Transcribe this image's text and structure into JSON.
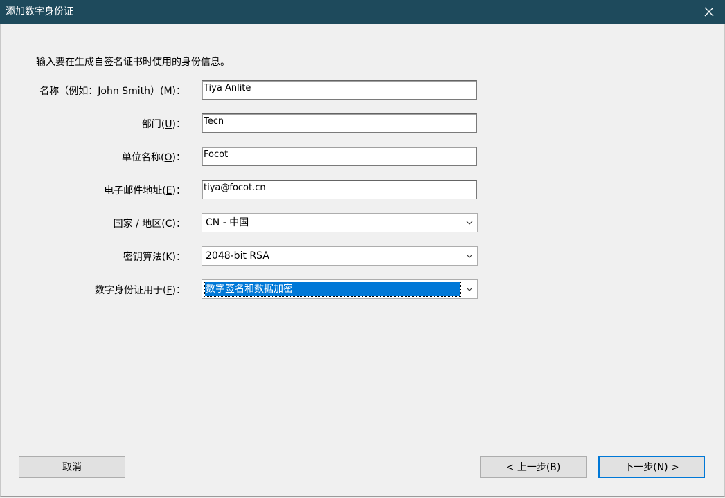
{
  "window": {
    "title": "添加数字身份证",
    "close_icon": "close-icon"
  },
  "instruction": "输入要在生成自签名证书时使用的身份信息。",
  "fields": {
    "name": {
      "label_pre": "名称（例如：John Smith）(",
      "key": "M",
      "label_post": ")：",
      "value": "Tiya Anlite"
    },
    "department": {
      "label_pre": "部门(",
      "key": "U",
      "label_post": ")：",
      "value": "Tecn"
    },
    "organization": {
      "label_pre": "单位名称(",
      "key": "O",
      "label_post": ")：",
      "value": "Focot"
    },
    "email": {
      "label_pre": "电子邮件地址(",
      "key": "E",
      "label_post": ")：",
      "value": "tiya@focot.cn"
    },
    "country": {
      "label_pre": "国家 / 地区(",
      "key": "C",
      "label_post": ")：",
      "value": "CN - 中国"
    },
    "key_algorithm": {
      "label_pre": "密钥算法(",
      "key": "K",
      "label_post": ")：",
      "value": "2048-bit RSA"
    },
    "usage": {
      "label_pre": "数字身份证用于(",
      "key": "F",
      "label_post": ")：",
      "value": "数字签名和数据加密"
    }
  },
  "buttons": {
    "cancel": "取消",
    "back": "< 上一步(B)",
    "next": "下一步(N) >"
  },
  "colors": {
    "titlebar": "#1e4a5c",
    "selection": "#0078d7"
  }
}
